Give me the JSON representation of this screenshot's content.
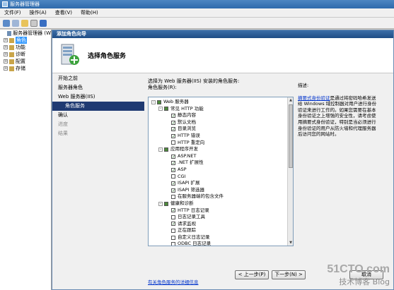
{
  "app": {
    "title": "服务器管理器"
  },
  "menu": [
    "文件(F)",
    "操作(A)",
    "查看(V)",
    "帮助(H)"
  ],
  "tree": [
    {
      "label": "服务器管理器 (W",
      "level": 0,
      "expander": "",
      "selected": false
    },
    {
      "label": "角色",
      "level": 1,
      "expander": "+",
      "selected": true
    },
    {
      "label": "功能",
      "level": 1,
      "expander": "+",
      "selected": false
    },
    {
      "label": "诊断",
      "level": 1,
      "expander": "+",
      "selected": false
    },
    {
      "label": "配置",
      "level": 1,
      "expander": "+",
      "selected": false
    },
    {
      "label": "存储",
      "level": 1,
      "expander": "+",
      "selected": false
    }
  ],
  "wizard": {
    "title": "添加角色向导",
    "heading": "选择角色服务",
    "steps": [
      {
        "label": "开始之前",
        "state": "normal",
        "sub": false
      },
      {
        "label": "服务器角色",
        "state": "normal",
        "sub": false
      },
      {
        "label": "Web 服务器(IIS)",
        "state": "normal",
        "sub": false
      },
      {
        "label": "角色服务",
        "state": "active",
        "sub": true
      },
      {
        "label": "确认",
        "state": "normal",
        "sub": false
      },
      {
        "label": "进度",
        "state": "dim",
        "sub": false
      },
      {
        "label": "结果",
        "state": "dim",
        "sub": false
      }
    ],
    "instruction_line1": "选择为 Web 服务器(IIS) 安装的角色服务:",
    "instruction_line2": "角色服务(R):",
    "services": [
      {
        "label": "Web 服务器",
        "level": 0,
        "exp": "-",
        "check": "partial"
      },
      {
        "label": "常见 HTTP 功能",
        "level": 1,
        "exp": "-",
        "check": "partial"
      },
      {
        "label": "静态内容",
        "level": 2,
        "exp": "",
        "check": "on"
      },
      {
        "label": "默认文档",
        "level": 2,
        "exp": "",
        "check": "on"
      },
      {
        "label": "目录浏览",
        "level": 2,
        "exp": "",
        "check": "on"
      },
      {
        "label": "HTTP 错误",
        "level": 2,
        "exp": "",
        "check": "on"
      },
      {
        "label": "HTTP 重定向",
        "level": 2,
        "exp": "",
        "check": "off"
      },
      {
        "label": "应用程序开发",
        "level": 1,
        "exp": "-",
        "check": "partial"
      },
      {
        "label": "ASP.NET",
        "level": 2,
        "exp": "",
        "check": "on"
      },
      {
        "label": ".NET 扩展性",
        "level": 2,
        "exp": "",
        "check": "on"
      },
      {
        "label": "ASP",
        "level": 2,
        "exp": "",
        "check": "on"
      },
      {
        "label": "CGI",
        "level": 2,
        "exp": "",
        "check": "off"
      },
      {
        "label": "ISAPI 扩展",
        "level": 2,
        "exp": "",
        "check": "on"
      },
      {
        "label": "ISAPI 筛选器",
        "level": 2,
        "exp": "",
        "check": "on"
      },
      {
        "label": "在服务器端的包含文件",
        "level": 2,
        "exp": "",
        "check": "off"
      },
      {
        "label": "健康和诊断",
        "level": 1,
        "exp": "-",
        "check": "partial"
      },
      {
        "label": "HTTP 日志记录",
        "level": 2,
        "exp": "",
        "check": "on"
      },
      {
        "label": "日志记录工具",
        "level": 2,
        "exp": "",
        "check": "off"
      },
      {
        "label": "请求监视",
        "level": 2,
        "exp": "",
        "check": "on"
      },
      {
        "label": "正在跟踪",
        "level": 2,
        "exp": "",
        "check": "off"
      },
      {
        "label": "自定义日志记录",
        "level": 2,
        "exp": "",
        "check": "off"
      },
      {
        "label": "ODBC 日志记录",
        "level": 2,
        "exp": "",
        "check": "off"
      }
    ],
    "description_heading": "描述:",
    "description_link": "摘要式身份验证",
    "description_text": "是通过将密码哈希发送给 Windows 域控制器对用户进行身份验证来进行工作的。如果您需要在基本身份验证之上增强的安全性，请考虑使用摘要式身份验证，特别是当必须进行身份验证的用户从防火墙和代理服务器后访问您的网站时。",
    "more_link": "有关角色服务的详细信息",
    "buttons": {
      "prev": "< 上一步(P)",
      "next": "下一步(N) >",
      "cancel": "取消"
    }
  },
  "watermark": {
    "line1": "51CTO.com",
    "line2": "技术博客 Blog"
  }
}
